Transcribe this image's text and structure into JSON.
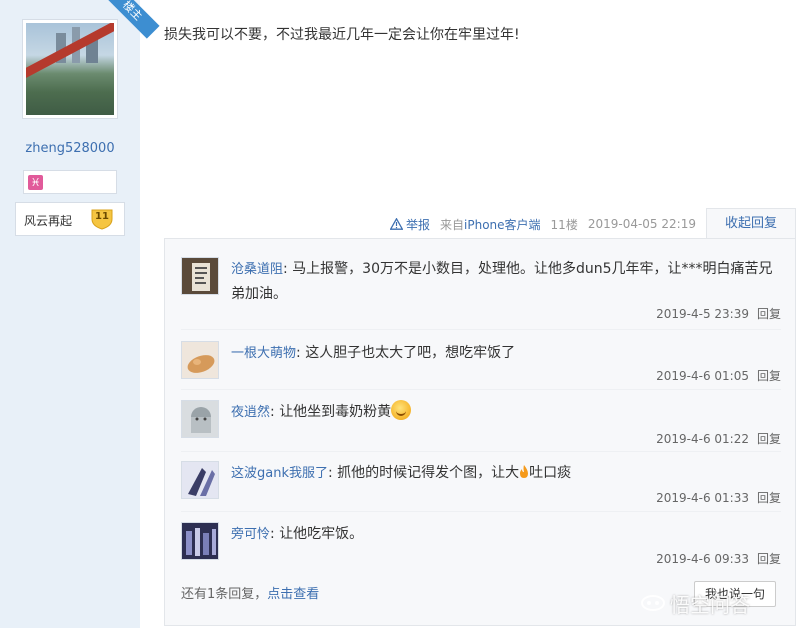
{
  "user": {
    "badge": "楼主",
    "name": "zheng528000",
    "zodiac_icon": "pisces-icon",
    "zodiac_glyph": "♓",
    "level_title": "风云再起",
    "level": "11"
  },
  "post": {
    "content": "损失我可以不要，不过我最近几年一定会让你在牢里过年!",
    "report_label": "举报",
    "source": "来自iPhone客户端",
    "floor": "11楼",
    "time": "2019-04-05 22:19",
    "collapse_label": "收起回复"
  },
  "comments": [
    {
      "name": "沧桑道阻",
      "sep": ": ",
      "text": "马上报警，30万不是小数目，处理他。让他多dun5几年牢，让***明白痛苦兄弟加油。",
      "time": "2019-4-5 23:39",
      "reply_label": "回复"
    },
    {
      "name": "一根大萌物",
      "sep": ": ",
      "text": "这人胆子也太大了吧，想吃牢饭了",
      "time": "2019-4-6 01:05",
      "reply_label": "回复"
    },
    {
      "name": "夜逍然",
      "sep": ": ",
      "text": "让他坐到毒奶粉黄",
      "time": "2019-4-6 01:22",
      "reply_label": "回复"
    },
    {
      "name": "这波gank我服了",
      "sep": ": ",
      "text_before": "抓他的时候记得发个图，让大",
      "text_after": "吐口痰",
      "time": "2019-4-6 01:33",
      "reply_label": "回复"
    },
    {
      "name": "旁可怜",
      "sep": ": ",
      "text": "让他吃牢饭。",
      "time": "2019-4-6 09:33",
      "reply_label": "回复"
    }
  ],
  "more": {
    "text": "还有1条回复，",
    "link": "点击查看"
  },
  "say_button": "我也说一句",
  "watermark": "悟空问答",
  "colors": {
    "link_blue": "#3d6fb0",
    "sidebar_bg": "#e8f0f8",
    "reply_box_bg": "#f7f8fa"
  }
}
